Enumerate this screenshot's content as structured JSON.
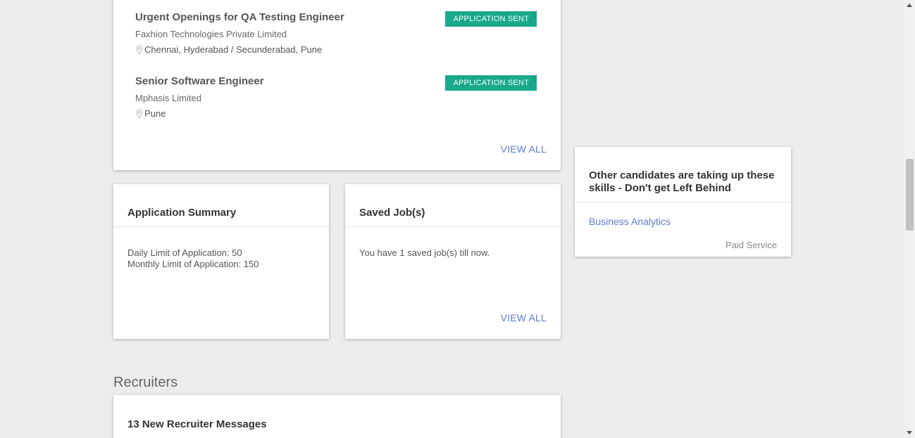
{
  "applications": {
    "jobs": [
      {
        "title": "Urgent Openings for QA Testing Engineer",
        "company": "Faxhion Technologies Private Limited",
        "location": "Chennai, Hyderabad / Secunderabad, Pune",
        "status": "APPLICATION SENT"
      },
      {
        "title": "Senior Software Engineer",
        "company": "Mphasis Limited",
        "location": "Pune",
        "status": "APPLICATION SENT"
      }
    ],
    "view_all": "VIEW ALL"
  },
  "summary": {
    "title": "Application Summary",
    "daily_limit": "Daily Limit of Application: 50",
    "monthly_limit": "Monthly Limit of Application: 150"
  },
  "saved_jobs": {
    "title": "Saved Job(s)",
    "text": "You have 1 saved job(s) till now.",
    "view_all": "VIEW ALL"
  },
  "skills": {
    "title": "Other candidates are taking up these skills - Don't get Left Behind",
    "link": "Business Analytics",
    "note": "Paid Service"
  },
  "recruiters": {
    "heading": "Recruiters",
    "messages_title": "13 New Recruiter Messages"
  },
  "colors": {
    "badge": "#1aa88b",
    "link": "#5b7bd5",
    "background": "#ececec"
  },
  "icons": {
    "location": "location-pin-icon"
  }
}
